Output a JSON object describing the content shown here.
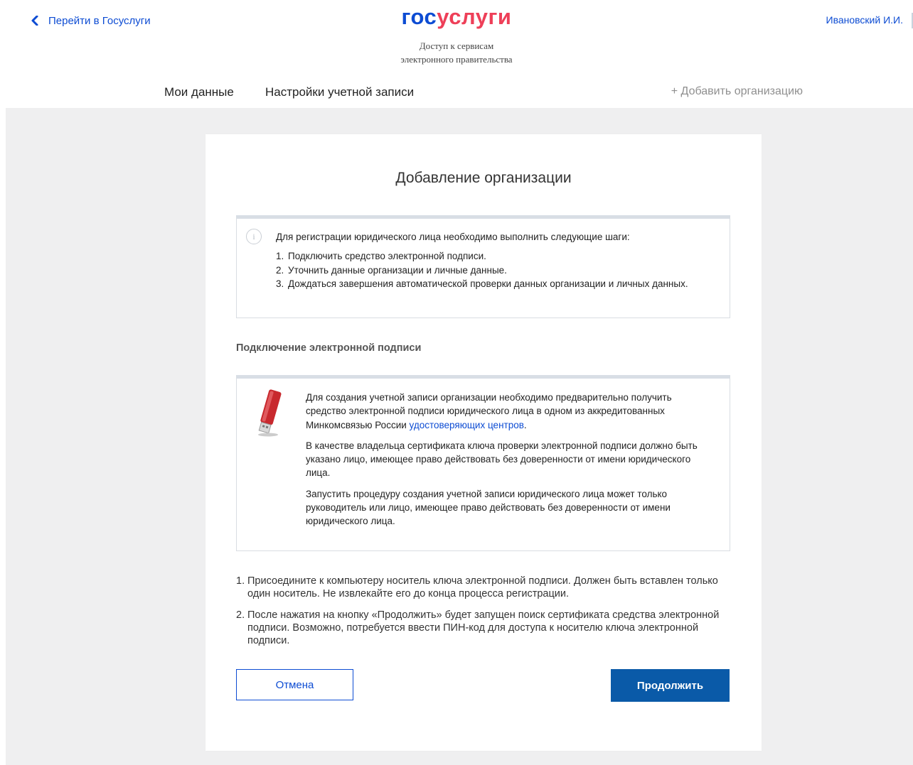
{
  "header": {
    "back_link": "Перейти в Госуслуги",
    "logo_part1": "гос",
    "logo_part2": "услуги",
    "tagline_line1": "Доступ к сервисам",
    "tagline_line2": "электронного правительства",
    "user_name": "Ивановский И.И."
  },
  "nav": {
    "items": [
      {
        "label": "Мои данные"
      },
      {
        "label": "Настройки учетной записи"
      }
    ],
    "add_org": "+ Добавить организацию"
  },
  "card": {
    "title": "Добавление организации",
    "info": {
      "icon": "info-icon",
      "lead": "Для регистрации юридического лица необходимо выполнить следующие шаги:",
      "steps": [
        {
          "num": "1.",
          "text": "Подключить средство электронной подписи."
        },
        {
          "num": "2.",
          "text": "Уточнить данные организации и личные данные."
        },
        {
          "num": "3.",
          "text": "Дождаться завершения автоматической проверки данных организации и личных данных."
        }
      ]
    },
    "section_heading": "Подключение электронной подписи",
    "signature": {
      "icon": "usb-token-icon",
      "p1_text": "Для создания учетной записи организации необходимо предварительно получить средство электронной подписи юридического лица в одном из аккредитованных Минкомсвязью России ",
      "p1_link": "удостоверяющих центров",
      "p1_end": ".",
      "p2": "В качестве владельца сертификата ключа проверки электронной подписи должно быть указано лицо, имеющее право действовать без доверенности от имени юридического лица.",
      "p3": "Запустить процедуру создания учетной записи юридического лица может только руководитель или лицо, имеющее право действовать без доверенности от имени юридического лица."
    },
    "instructions": [
      {
        "num": "1.",
        "text": "Присоедините к компьютеру носитель ключа электронной подписи. Должен быть вставлен только один носитель. Не извлекайте его до конца процесса регистрации."
      },
      {
        "num": "2.",
        "text": "После нажатия на кнопку «Продолжить» будет запущен поиск сертификата средства электронной подписи. Возможно, потребуется ввести ПИН-код для доступа к носителю ключа электронной подписи."
      }
    ],
    "cancel_label": "Отмена",
    "continue_label": "Продолжить"
  },
  "colors": {
    "brand_blue": "#0d4cd3",
    "brand_red": "#ee3f58",
    "button_blue": "#0a5aa8",
    "background_grey": "#efeff0"
  }
}
